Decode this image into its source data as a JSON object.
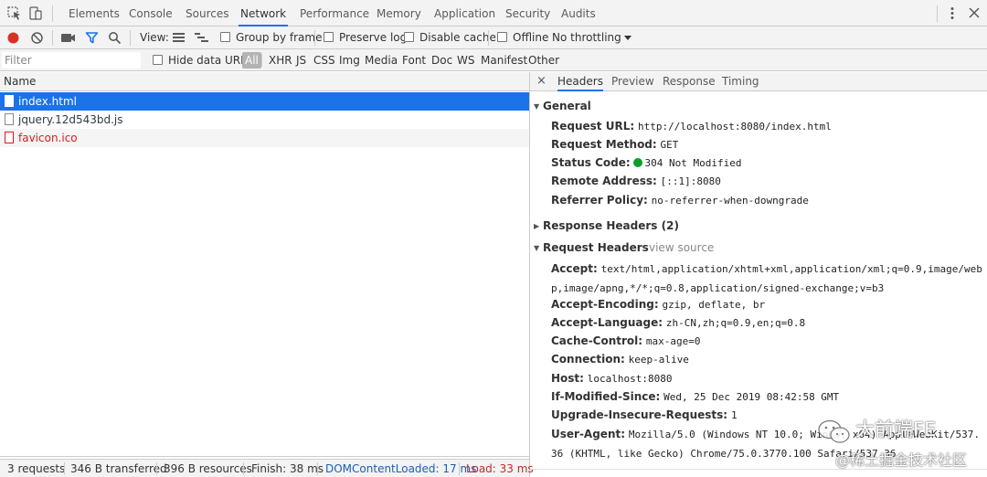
{
  "tabbar": {
    "tabs": [
      "Elements",
      "Console",
      "Sources",
      "Network",
      "Performance",
      "Memory",
      "Application",
      "Security",
      "Audits"
    ],
    "active_tab": "Network"
  },
  "toolbar": {
    "view_label": "View:",
    "group_by_frame": "Group by frame",
    "preserve_log": "Preserve log",
    "disable_cache": "Disable cache",
    "offline": "Offline",
    "throttling": "No throttling"
  },
  "filterbar": {
    "placeholder": "Filter",
    "hide_data_urls": "Hide data URLs",
    "types": [
      "All",
      "XHR",
      "JS",
      "CSS",
      "Img",
      "Media",
      "Font",
      "Doc",
      "WS",
      "Manifest",
      "Other"
    ],
    "active_type": "All"
  },
  "request_list": {
    "header": "Name",
    "rows": [
      {
        "name": "index.html",
        "state": "selected"
      },
      {
        "name": "jquery.12d543bd.js",
        "state": "normal"
      },
      {
        "name": "favicon.ico",
        "state": "error"
      }
    ]
  },
  "statusbar": {
    "requests": "3 requests",
    "transferred": "346 B transferred",
    "resources": "396 B resources",
    "finish": "Finish: 38 ms",
    "dom_content_loaded": "DOMContentLoaded: 17 ms",
    "load": "Load: 33 ms"
  },
  "details": {
    "close": "×",
    "tabs": [
      "Headers",
      "Preview",
      "Response",
      "Timing"
    ],
    "active_tab": "Headers",
    "general": {
      "title": "General",
      "rows": [
        {
          "key": "Request URL:",
          "value": "http://localhost:8080/index.html"
        },
        {
          "key": "Request Method:",
          "value": "GET"
        },
        {
          "key": "Status Code:",
          "value": "304 Not Modified"
        },
        {
          "key": "Remote Address:",
          "value": "[::1]:8080"
        },
        {
          "key": "Referrer Policy:",
          "value": "no-referrer-when-downgrade"
        }
      ]
    },
    "response_headers": {
      "title": "Response Headers (2)"
    },
    "request_headers": {
      "title": "Request Headers",
      "view_source": "view source",
      "accept": {
        "key": "Accept:",
        "value": "text/html,application/xhtml+xml,application/xml;q=0.9,image/webp,image/apng,*/*;q=0.8,application/signed-exchange;v=b3"
      },
      "rows": [
        {
          "key": "Accept-Encoding:",
          "value": "gzip, deflate, br"
        },
        {
          "key": "Accept-Language:",
          "value": "zh-CN,zh;q=0.9,en;q=0.8"
        },
        {
          "key": "Cache-Control:",
          "value": "max-age=0"
        },
        {
          "key": "Connection:",
          "value": "keep-alive"
        },
        {
          "key": "Host:",
          "value": "localhost:8080"
        },
        {
          "key": "If-Modified-Since:",
          "value": "Wed, 25 Dec 2019 08:42:58 GMT"
        },
        {
          "key": "Upgrade-Insecure-Requests:",
          "value": "1"
        }
      ],
      "user_agent": {
        "key": "User-Agent:",
        "value": "Mozilla/5.0 (Windows NT 10.0; Win64; x64) AppleWebKit/537.36 (KHTML, like Gecko) Chrome/75.0.3770.100 Safari/537.36"
      }
    }
  },
  "watermark": {
    "line1": "大前端FE",
    "line2": "@稀土掘金技术社区"
  },
  "colors": {
    "accent": "#1a73e8",
    "record": "#d93025",
    "status_ok": "#0a9f2a",
    "error_text": "#e0171d"
  }
}
